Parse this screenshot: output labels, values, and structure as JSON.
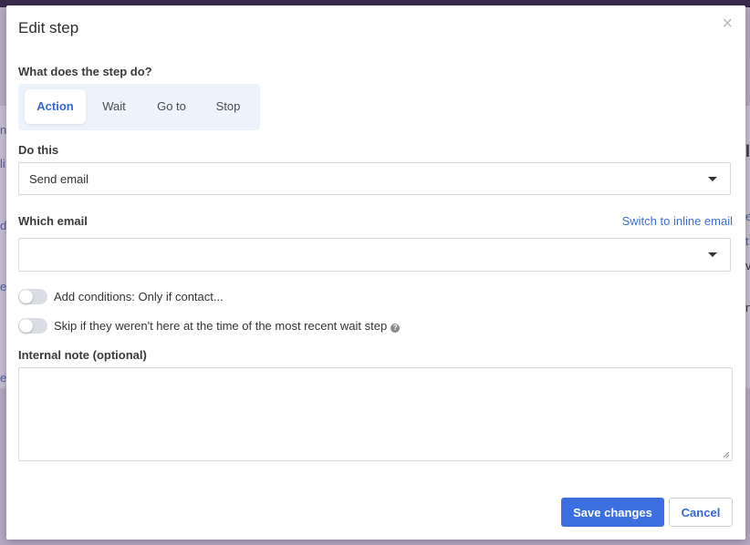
{
  "background": {
    "left_fragments": [
      "n",
      "li",
      "di",
      "e",
      "e"
    ],
    "right_fragments": [
      "l",
      "e",
      "t",
      "va",
      "n"
    ]
  },
  "modal": {
    "title": "Edit step",
    "close_glyph": "×"
  },
  "step_type": {
    "label": "What does the step do?",
    "options": [
      "Action",
      "Wait",
      "Go to",
      "Stop"
    ],
    "selected": "Action"
  },
  "do_this": {
    "label": "Do this",
    "value": "Send email"
  },
  "which_email": {
    "label": "Which email",
    "switch_link": "Switch to inline email",
    "value": ""
  },
  "toggles": {
    "conditions_label": "Add conditions: Only if contact...",
    "skip_label": "Skip if they weren't here at the time of the most recent wait step",
    "help_glyph": "?"
  },
  "note": {
    "label": "Internal note (optional)",
    "value": ""
  },
  "footer": {
    "save_label": "Save changes",
    "cancel_label": "Cancel"
  },
  "colors": {
    "accent": "#3b6fe0",
    "link": "#3b6fd3",
    "segment_bg": "#edf3fb"
  }
}
